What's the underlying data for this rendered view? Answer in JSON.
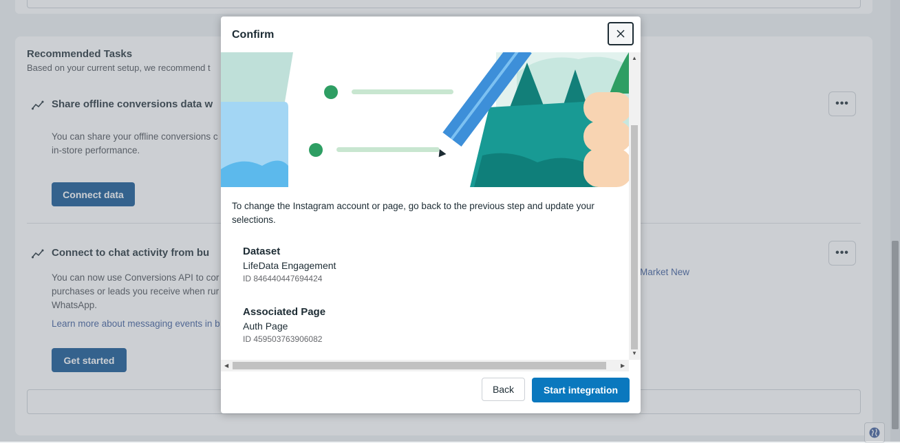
{
  "background": {
    "section_title": "Recommended Tasks",
    "section_subtitle": "Based on your current setup, we recommend t",
    "task1": {
      "title": "Share offline conversions data w",
      "text": "You can share your offline conversions c in-store performance.",
      "button": "Connect data"
    },
    "task2": {
      "title": "Connect to chat activity from bu",
      "text": "You can now use Conversions API to cor purchases or leads you receive when rur WhatsApp.",
      "link": "Learn more about messaging events in b",
      "button": "Get started",
      "right_link": "Market New"
    },
    "more_label": "•••"
  },
  "modal": {
    "title": "Confirm",
    "info_text": "To change the Instagram account or page, go back to the previous step and update your selections.",
    "dataset": {
      "label": "Dataset",
      "name": "LifeData Engagement",
      "id": "ID 846440447694424"
    },
    "page": {
      "label": "Associated Page",
      "name": "Auth Page",
      "id": "ID 459503763906082"
    },
    "back_label": "Back",
    "start_label": "Start integration"
  },
  "icons": {
    "close": "close-icon",
    "task": "trend-icon",
    "globe": "globe-icon"
  },
  "colors": {
    "primary": "#0a78be",
    "primary_dark": "#0a4f8f",
    "teal": "#189a94",
    "link": "#385898"
  }
}
